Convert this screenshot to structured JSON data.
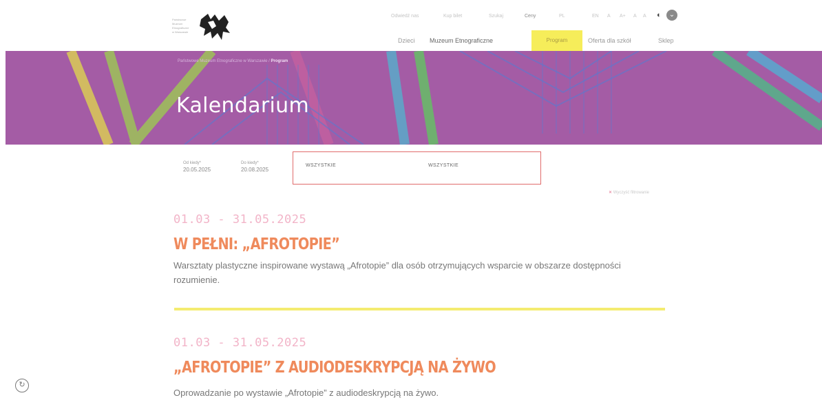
{
  "header": {
    "logo_lines": [
      "Państwowe",
      "Muzeum",
      "Etnograficzne",
      "w Warszawie"
    ],
    "top_links": [
      "Odwiedź nas",
      "Kup bilet",
      "Szukaj",
      "Ceny",
      "PL",
      "EN",
      "A",
      "A+",
      "A",
      "A"
    ],
    "nav": {
      "items": [
        "Dzieci",
        "Muzeum Etnograficzne",
        "Program",
        "Oferta dla szkół",
        "Sklep"
      ],
      "active": "Program"
    }
  },
  "banner": {
    "breadcrumb_root": "Państwowe Muzeum Etnograficzne w Warszawie /",
    "breadcrumb_current": "Program",
    "title": "Kalendarium"
  },
  "filters": {
    "from_label": "Od kiedy*",
    "from_value": "20.05.2025",
    "to_label": "Do kiedy*",
    "to_value": "20.08.2025",
    "select_1": "WSZYSTKIE",
    "select_2": "WSZYSTKIE",
    "clear_label": "Wyczyść filtrowanie"
  },
  "events": [
    {
      "date": "01.03 - 31.05.2025",
      "title": "W PEŁNI: „AFROTOPIE”",
      "description": "Warsztaty plastyczne inspirowane wystawą „Afrotopie” dla osób otrzymujących wsparcie w obszarze dostępności rozumienie."
    },
    {
      "date": "01.03 - 31.05.2025",
      "title": "„AFROTOPIE” Z AUDIODESKRYPCJĄ NA ŻYWO",
      "description": "Oprowadzanie po wystawie „Afrotopie” z audiodeskrypcją na żywo."
    }
  ],
  "colors": {
    "banner": "#a45ca5",
    "accent_yellow": "#f6ed5a",
    "event_title": "#ef8a5c",
    "event_date": "#f2b4c8",
    "filter_highlight": "#e06a6a"
  },
  "icons": {
    "contrast_toggle": "moon-icon",
    "user_circle": "user-icon",
    "side_tool": "history-icon"
  }
}
